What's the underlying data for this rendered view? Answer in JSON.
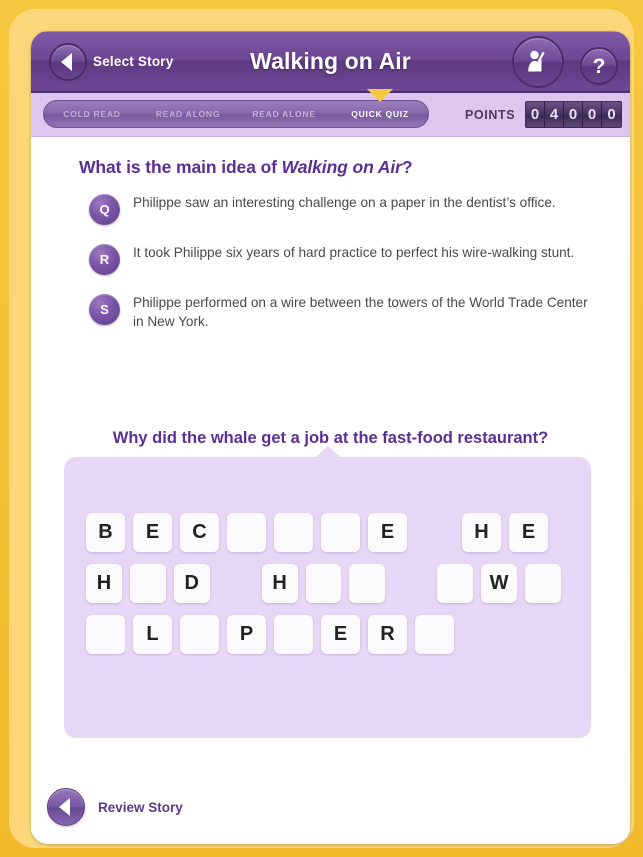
{
  "header": {
    "back_label": "Select Story",
    "title": "Walking on Air",
    "teacher_icon": "teacher-pointer-icon",
    "help_label": "?"
  },
  "nav": {
    "tabs": [
      {
        "label": "COLD READ",
        "active": false
      },
      {
        "label": "READ ALONG",
        "active": false
      },
      {
        "label": "READ ALONE",
        "active": false
      },
      {
        "label": "QUICK QUIZ",
        "active": true
      }
    ],
    "points_label": "POINTS",
    "points_digits": [
      "0",
      "4",
      "0",
      "0",
      "0"
    ]
  },
  "quiz": {
    "question_prefix": "What is the main idea of ",
    "question_title": "Walking on Air",
    "question_suffix": "?",
    "answers": [
      {
        "badge": "Q",
        "text": "Philippe saw an interesting challenge on a paper in the dentist’s office."
      },
      {
        "badge": "R",
        "text": "It took Philippe six years of hard practice to perfect his wire-walking stunt."
      },
      {
        "badge": "S",
        "text": "Philippe performed on a wire between the towers of the World Trade Center in New York."
      }
    ]
  },
  "riddle": {
    "question": "Why did the whale get a job at the fast-food restaurant?",
    "rows": [
      [
        "B",
        "E",
        "C",
        "",
        "",
        "",
        "E",
        null,
        "H",
        "E"
      ],
      [
        "H",
        "",
        "D",
        null,
        "H",
        "",
        "",
        null,
        "",
        "W",
        ""
      ],
      [
        "",
        "L",
        "",
        "P",
        "",
        "E",
        "R",
        ""
      ]
    ]
  },
  "footer": {
    "review_label": "Review Story"
  },
  "colors": {
    "frame": "#f5c13f",
    "bezel": "#fbd77a",
    "title_bar": "#6e4694",
    "nav_strip": "#dcc8ef",
    "accent_purple": "#5b2f93",
    "riddle_panel": "#e6d7f7",
    "caret_yellow": "#f7c93f"
  }
}
